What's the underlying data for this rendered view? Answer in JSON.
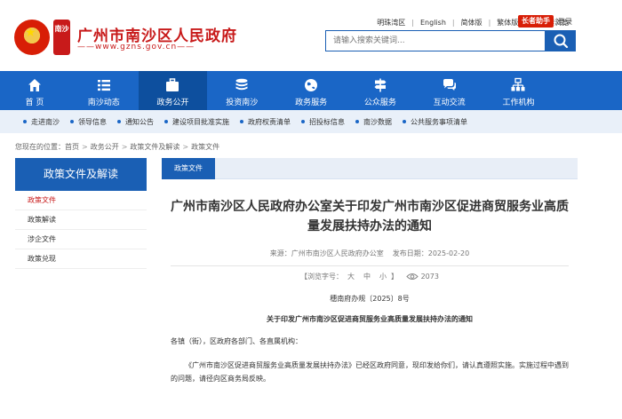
{
  "header": {
    "site_title": "广州市南沙区人民政府",
    "site_url": "——www.gzns.gov.cn——",
    "seal_text": "南沙",
    "top_links": [
      "明珠湾区",
      "English",
      "简体版",
      "繁体版",
      "无障碍浏览"
    ],
    "assist_label": "长者助手",
    "login_label": "登录",
    "search_placeholder": "请输入搜索关键词..."
  },
  "nav": {
    "items": [
      {
        "label": "首 页",
        "icon": "home-icon"
      },
      {
        "label": "南沙动态",
        "icon": "list-icon"
      },
      {
        "label": "政务公开",
        "icon": "briefcase-icon"
      },
      {
        "label": "投资南沙",
        "icon": "coins-icon"
      },
      {
        "label": "政务服务",
        "icon": "globe-icon"
      },
      {
        "label": "公众服务",
        "icon": "signpost-icon"
      },
      {
        "label": "互动交流",
        "icon": "chat-icon"
      },
      {
        "label": "工作机构",
        "icon": "org-chart-icon"
      }
    ]
  },
  "subnav": {
    "items": [
      "走进南沙",
      "领导信息",
      "通知公告",
      "建设项目批准实施",
      "政府权责清单",
      "招投标信息",
      "南沙数据",
      "公共服务事项清单"
    ]
  },
  "breadcrumb": {
    "prefix": "您现在的位置：",
    "items": [
      "首页",
      "政务公开",
      "政策文件及解读",
      "政策文件"
    ]
  },
  "sidebar": {
    "title": "政策文件及解读",
    "items": [
      "政策文件",
      "政策解读",
      "涉企文件",
      "政策兑现"
    ]
  },
  "main": {
    "tab_label": "政策文件",
    "title": "广州市南沙区人民政府办公室关于印发广州市南沙区促进商贸服务业高质量发展扶持办法的通知",
    "source": "来源：广州市南沙区人民政府办公室",
    "published": "发布日期：2025-02-20",
    "font_size_label": "【浏览字号：",
    "sizes": [
      "大",
      "中",
      "小"
    ],
    "font_size_close": "】",
    "views": "2073",
    "doc_number": "穗南府办规〔2025〕8号",
    "doc_title": "关于印发广州市南沙区促进商贸服务业高质量发展扶持办法的通知",
    "salutation": "各镇（街），区政府各部门、各直属机构：",
    "body": "《广州市南沙区促进商贸服务业高质量发展扶持办法》已经区政府同意，现印发给你们，请认真遵照实施。实施过程中遇到的问题，请径向区商务局反映。"
  },
  "colors": {
    "brand_red": "#c81a1a",
    "nav_blue": "#1a66c6",
    "nav_active": "#0d4f9e",
    "subnav_bg": "#e9f0f9"
  }
}
